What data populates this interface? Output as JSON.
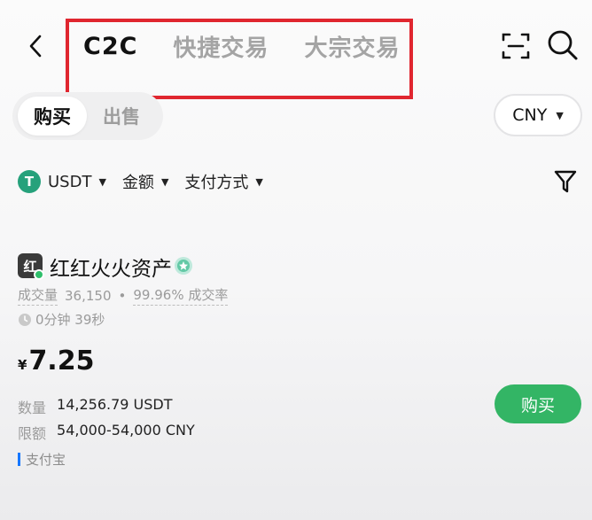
{
  "header": {
    "tabs": [
      {
        "label": "C2C",
        "active": true
      },
      {
        "label": "快捷交易",
        "active": false
      },
      {
        "label": "大宗交易",
        "active": false
      }
    ],
    "highlight_color": "#e0262f"
  },
  "side_toggle": {
    "buy_label": "购买",
    "sell_label": "出售",
    "selected": "购买"
  },
  "currency_selector": {
    "value": "CNY"
  },
  "filters": {
    "coin": {
      "icon": "tether-icon",
      "icon_glyph": "T",
      "label": "USDT"
    },
    "amount_label": "金额",
    "payment_label": "支付方式"
  },
  "merchant": {
    "avatar_text": "红",
    "name": "红红火火资产",
    "orders_label": "成交量",
    "orders_value": "36,150",
    "completion_value": "99.96%",
    "completion_label": "成交率",
    "time": "0分钟 39秒"
  },
  "offer": {
    "currency_symbol": "¥",
    "price": "7.25",
    "quantity_label": "数量",
    "quantity_value": "14,256.79 USDT",
    "limit_label": "限额",
    "limit_value": "54,000-54,000 CNY",
    "payment_method": "支付宝",
    "buy_button": "购买"
  },
  "colors": {
    "accent_green": "#33b565",
    "usdt_green": "#26a17b",
    "alipay_blue": "#1677ff"
  }
}
